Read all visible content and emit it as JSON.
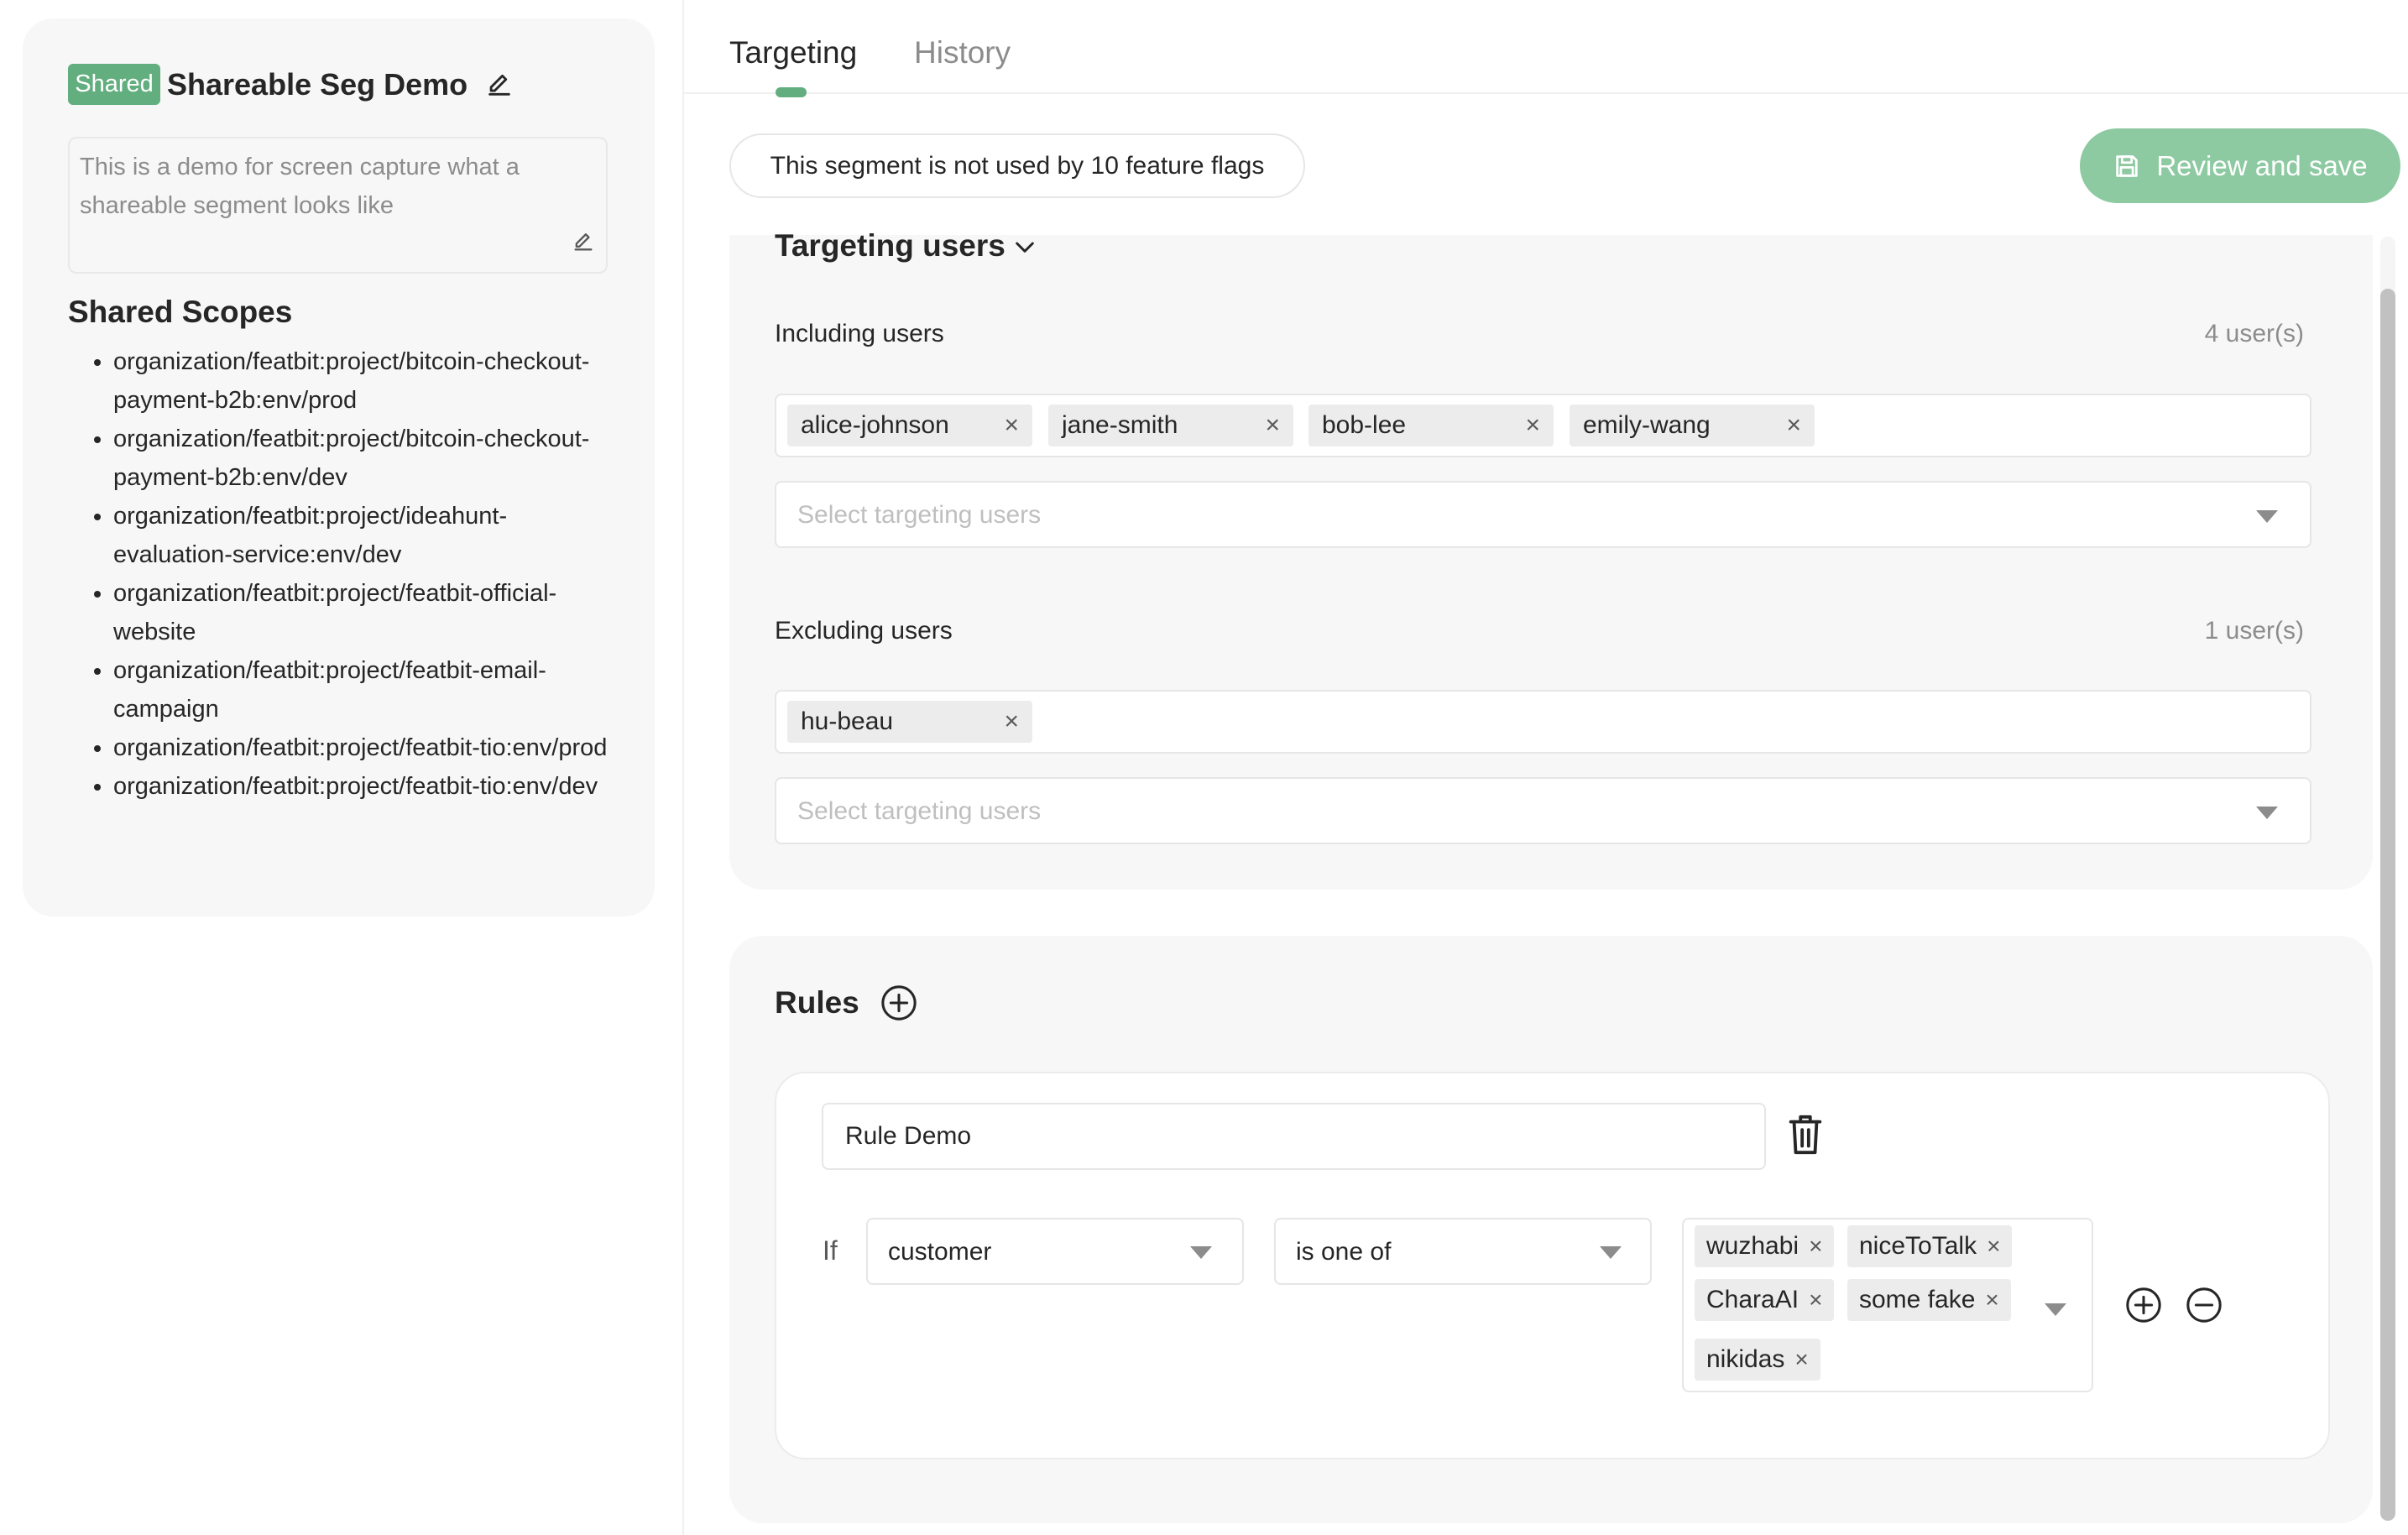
{
  "segment": {
    "badge": "Shared",
    "title": "Shareable Seg Demo",
    "description": "This is a demo for screen capture what a shareable segment looks like"
  },
  "scopes": {
    "title": "Shared Scopes",
    "items": [
      "organization/featbit:project/bitcoin-checkout-payment-b2b:env/prod",
      "organization/featbit:project/bitcoin-checkout-payment-b2b:env/dev",
      "organization/featbit:project/ideahunt-evaluation-service:env/dev",
      "organization/featbit:project/featbit-official-website",
      "organization/featbit:project/featbit-email-campaign",
      "organization/featbit:project/featbit-tio:env/prod",
      "organization/featbit:project/featbit-tio:env/dev"
    ]
  },
  "tabs": [
    {
      "label": "Targeting",
      "active": true
    },
    {
      "label": "History",
      "active": false
    }
  ],
  "usage_text": "This segment is not used by 10 feature flags",
  "save_label": "Review and save",
  "targeting": {
    "title": "Targeting users",
    "including": {
      "label": "Including users",
      "count": "4 user(s)",
      "users": [
        "alice-johnson",
        "jane-smith",
        "bob-lee",
        "emily-wang"
      ],
      "placeholder": "Select targeting users"
    },
    "excluding": {
      "label": "Excluding users",
      "count": "1 user(s)",
      "users": [
        "hu-beau"
      ],
      "placeholder": "Select targeting users"
    }
  },
  "rules": {
    "title": "Rules",
    "items": [
      {
        "name": "Rule Demo",
        "if_label": "If",
        "attribute": "customer",
        "operator": "is one of",
        "values": [
          "wuzhabi",
          "niceToTalk",
          "CharaAI",
          "some fake",
          "nikidas"
        ]
      }
    ]
  },
  "colors": {
    "accent": "#62ae7f",
    "save_button": "#8dc9a1",
    "card_background": "#f7f7f7"
  },
  "icons": {
    "title_edit": "pencil-icon",
    "description_edit": "pencil-icon",
    "targeting_toggle": "chevron-down-icon",
    "save": "save-icon",
    "rules_add": "add-circle-icon",
    "rule_delete": "trash-icon",
    "condition_add": "add-circle-icon",
    "condition_remove": "remove-circle-icon",
    "dropdown": "caret-down-icon",
    "chip_remove": "close-icon"
  }
}
